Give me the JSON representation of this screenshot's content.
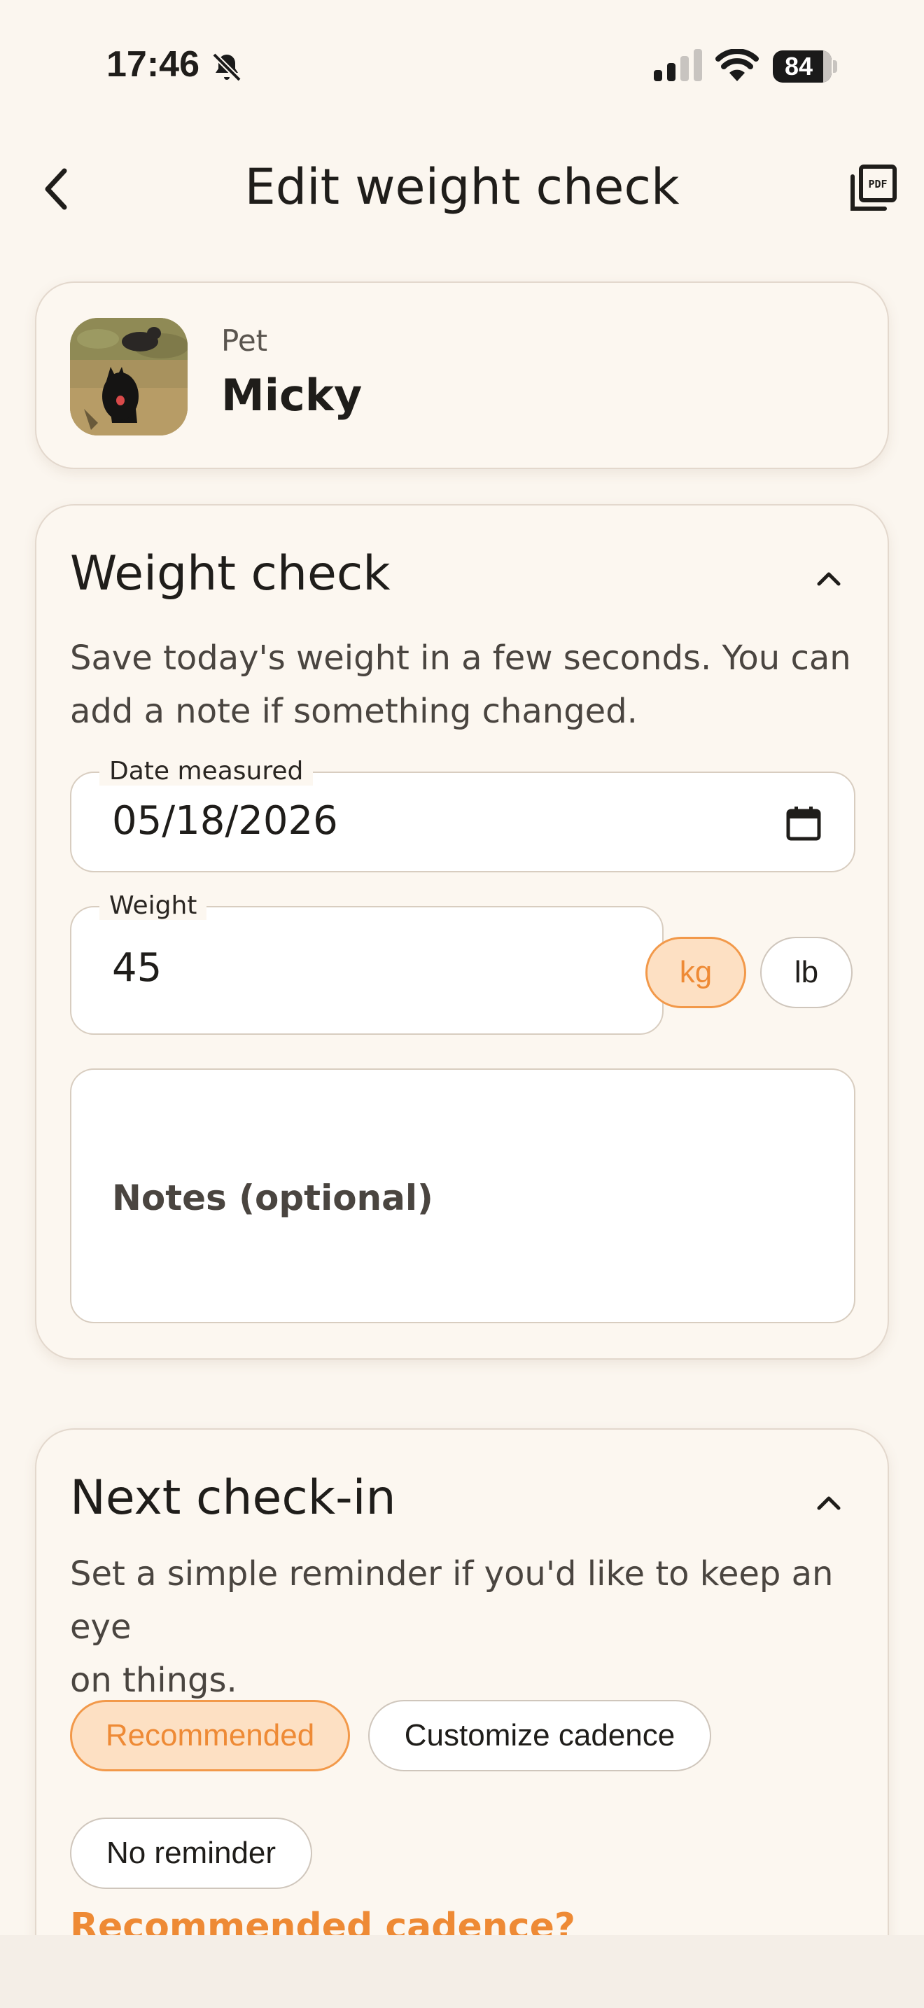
{
  "status_bar": {
    "time": "17:46",
    "battery": "84"
  },
  "header": {
    "title": "Edit weight check"
  },
  "pet": {
    "label": "Pet",
    "name": "Micky"
  },
  "weight_check": {
    "title": "Weight check",
    "description_line1": "Save today's weight in a few seconds. You can",
    "description_line2": "add a note if something changed.",
    "date_label": "Date measured",
    "date_value": "05/18/2026",
    "weight_label": "Weight",
    "weight_value": "45",
    "units": [
      "kg",
      "lb"
    ],
    "selected_unit": "kg",
    "notes_placeholder": "Notes (optional)"
  },
  "next_checkin": {
    "title": "Next check-in",
    "description_line1": "Set a simple reminder if you'd like to keep an eye",
    "description_line2": "on things.",
    "options": [
      "Recommended",
      "Customize cadence",
      "No reminder"
    ],
    "selected_option": "Recommended",
    "partial_heading": "Recommended cadence?"
  },
  "colors": {
    "accent": "#ee8a35",
    "accent_bg": "#fde0c3",
    "background": "#fbf6ef"
  }
}
